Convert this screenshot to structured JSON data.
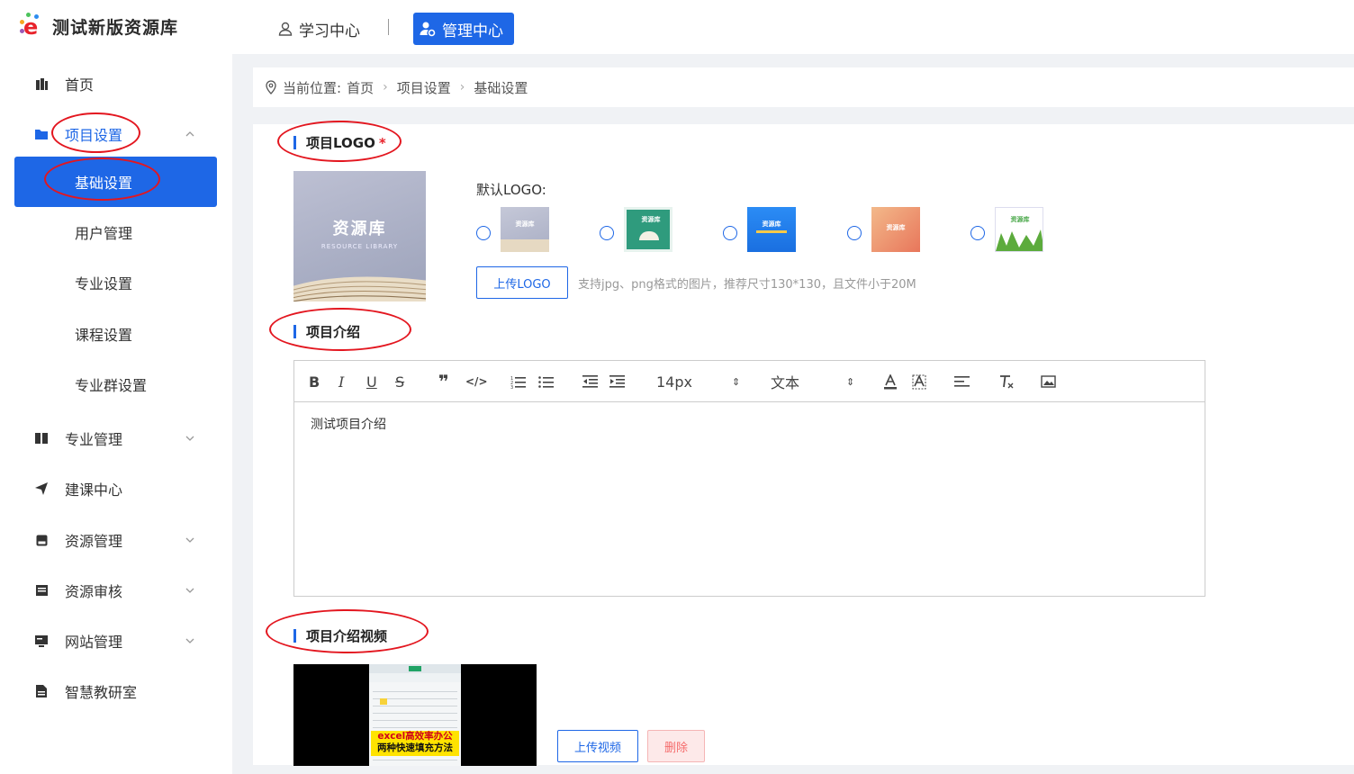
{
  "app": {
    "title": "测试新版资源库"
  },
  "top_nav": {
    "learn_label": "学习中心",
    "manage_label": "管理中心"
  },
  "sidebar": {
    "items": [
      {
        "label": "首页",
        "icon": "home-icon"
      },
      {
        "label": "项目设置",
        "icon": "folder-icon",
        "expanded": true,
        "children": [
          {
            "label": "基础设置",
            "active": true
          },
          {
            "label": "用户管理"
          },
          {
            "label": "专业设置"
          },
          {
            "label": "课程设置"
          },
          {
            "label": "专业群设置"
          }
        ]
      },
      {
        "label": "专业管理",
        "icon": "book-icon"
      },
      {
        "label": "建课中心",
        "icon": "send-icon"
      },
      {
        "label": "资源管理",
        "icon": "drive-icon"
      },
      {
        "label": "资源审核",
        "icon": "list-icon"
      },
      {
        "label": "网站管理",
        "icon": "monitor-icon"
      },
      {
        "label": "智慧教研室",
        "icon": "doc-icon"
      }
    ]
  },
  "breadcrumb": {
    "prefix": "当前位置:",
    "items": [
      "首页",
      "项目设置",
      "基础设置"
    ]
  },
  "logo_section": {
    "title": "项目LOGO",
    "required_mark": "*",
    "preview_title": "资源库",
    "preview_subtitle": "RESOURCE LIBRARY",
    "default_label": "默认LOGO:",
    "thumb_text": "资源库",
    "upload_button": "上传LOGO",
    "hint": "支持jpg、png格式的图片，推荐尺寸130*130，且文件小于20M"
  },
  "intro_section": {
    "title": "项目介绍",
    "toolbar": {
      "font_size": "14px",
      "block_type": "文本"
    },
    "content": "测试项目介绍"
  },
  "video_section": {
    "title": "项目介绍视频",
    "video_caption_line1": "excel高效率办公",
    "video_caption_line2": "两种快速填充方法",
    "upload_button": "上传视频",
    "delete_button": "删除"
  },
  "colors": {
    "accent": "#1e67e6",
    "annotation": "#e3161f",
    "danger": "#f56c6c"
  }
}
